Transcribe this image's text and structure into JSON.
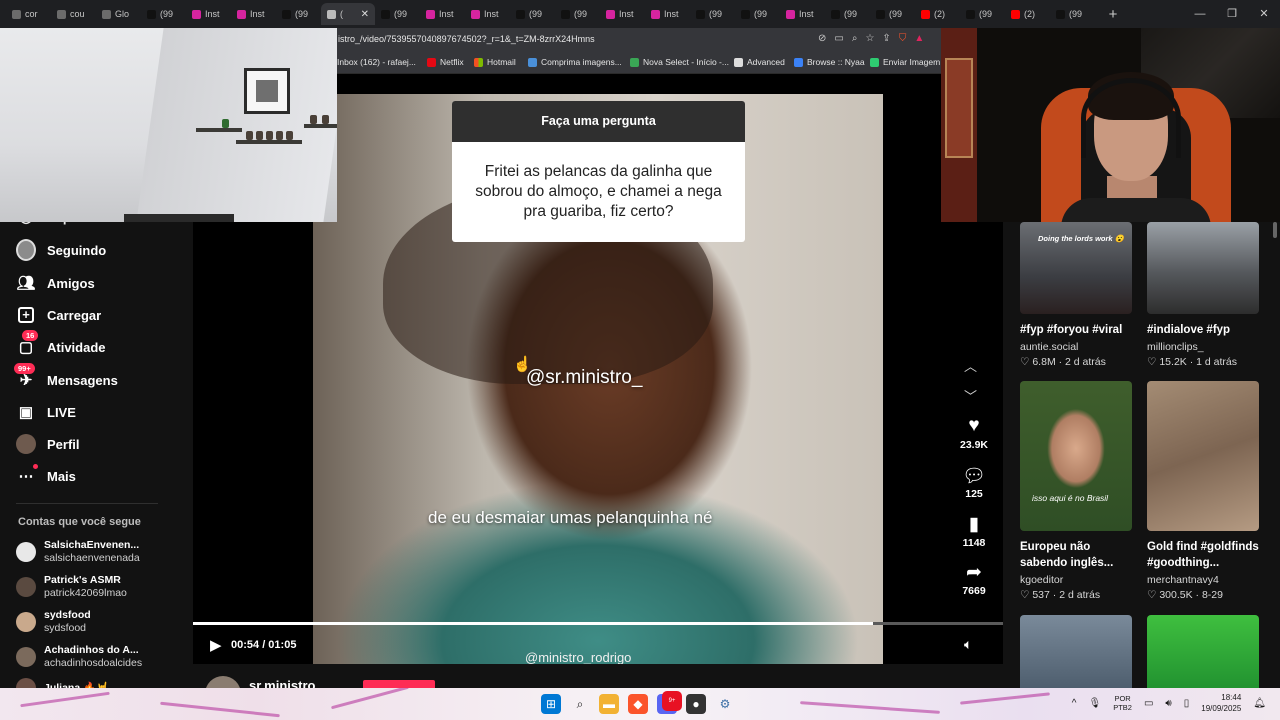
{
  "browser": {
    "tabs": [
      {
        "label": "cor",
        "icon": "search-icon",
        "color": "#6b6b6b"
      },
      {
        "label": "cou",
        "icon": "search-icon",
        "color": "#6b6b6b"
      },
      {
        "label": "Glo",
        "icon": "search-icon",
        "color": "#6b6b6b"
      },
      {
        "label": "(99",
        "icon": "tiktok-icon",
        "color": "#111111"
      },
      {
        "label": "Inst",
        "icon": "instagram-icon",
        "color": "#d6249f"
      },
      {
        "label": "Inst",
        "icon": "instagram-icon",
        "color": "#d6249f"
      },
      {
        "label": "(99",
        "icon": "tiktok-icon",
        "color": "#111111"
      },
      {
        "label": "(",
        "icon": "speaker-icon",
        "color": "#bbbbbb",
        "active": true
      },
      {
        "label": "(99",
        "icon": "tiktok-icon",
        "color": "#111111"
      },
      {
        "label": "Inst",
        "icon": "instagram-icon",
        "color": "#d6249f"
      },
      {
        "label": "Inst",
        "icon": "instagram-icon",
        "color": "#d6249f"
      },
      {
        "label": "(99",
        "icon": "tiktok-icon",
        "color": "#111111"
      },
      {
        "label": "(99",
        "icon": "tiktok-icon",
        "color": "#111111"
      },
      {
        "label": "Inst",
        "icon": "instagram-icon",
        "color": "#d6249f"
      },
      {
        "label": "Inst",
        "icon": "instagram-icon",
        "color": "#d6249f"
      },
      {
        "label": "(99",
        "icon": "tiktok-icon",
        "color": "#111111"
      },
      {
        "label": "(99",
        "icon": "tiktok-icon",
        "color": "#111111"
      },
      {
        "label": "Inst",
        "icon": "instagram-icon",
        "color": "#d6249f"
      },
      {
        "label": "(99",
        "icon": "tiktok-icon",
        "color": "#111111"
      },
      {
        "label": "(99",
        "icon": "tiktok-icon",
        "color": "#111111"
      },
      {
        "label": "(2)",
        "icon": "youtube-icon",
        "color": "#ff0000"
      },
      {
        "label": "(99",
        "icon": "tiktok-icon",
        "color": "#111111"
      },
      {
        "label": "(2)",
        "icon": "youtube-icon",
        "color": "#ff0000"
      },
      {
        "label": "(99",
        "icon": "tiktok-icon",
        "color": "#111111"
      }
    ],
    "new_tab": "+",
    "url": "istro_/video/7539557040897674502?_r=1&_t=ZM-8zrrX24Hmns",
    "bookmarks": [
      {
        "label": "Inbox (162) - rafaej...",
        "color": "#ea4335"
      },
      {
        "label": "Netflix",
        "color": "#e50914"
      },
      {
        "label": "Hotmail",
        "color": "#f25022"
      },
      {
        "label": "Comprima imagens...",
        "color": "#4a90d9"
      },
      {
        "label": "Nova Select - Início -...",
        "color": "#3aa655"
      },
      {
        "label": "Advanced",
        "color": "#dddddd"
      },
      {
        "label": "Browse :: Nyaa",
        "color": "#3b82f6"
      },
      {
        "label": "Enviar Imagem p",
        "color": "#2ecc71"
      }
    ]
  },
  "sidebar": {
    "nav": [
      {
        "label": "Explorar",
        "icon": "compass-icon"
      },
      {
        "label": "Seguindo",
        "icon": "following-avatar-icon"
      },
      {
        "label": "Amigos",
        "icon": "friends-icon"
      },
      {
        "label": "Carregar",
        "icon": "upload-icon"
      },
      {
        "label": "Atividade",
        "icon": "activity-icon",
        "badge": "16"
      },
      {
        "label": "Mensagens",
        "icon": "messages-icon",
        "badge": "99+"
      },
      {
        "label": "LIVE",
        "icon": "live-icon"
      },
      {
        "label": "Perfil",
        "icon": "profile-avatar-icon"
      },
      {
        "label": "Mais",
        "icon": "more-icon"
      }
    ],
    "following_title": "Contas que você segue",
    "accounts": [
      {
        "name": "SalsichaEnvenen...",
        "handle": "salsichaenvenenada"
      },
      {
        "name": "Patrick's ASMR",
        "handle": "patrick42069lmao"
      },
      {
        "name": "sydsfood",
        "handle": "sydsfood"
      },
      {
        "name": "Achadinhos do A...",
        "handle": "achadinhosdoalcides"
      },
      {
        "name": "Juliana 🔥🤘",
        "handle": ""
      }
    ]
  },
  "video": {
    "question_header": "Faça uma pergunta",
    "question_text": "Fritei as pelancas da galinha que sobrou do almoço, e chamei a nega pra guariba, fiz certo?",
    "handle_overlay": "@sr.ministro_",
    "caption": "de eu desmaiar umas pelanquinha né",
    "bottom_handle": "@ministro_rodrigo",
    "time": "00:54 / 01:05",
    "progress": 0.84,
    "likes": "23.9K",
    "comments": "125",
    "saves": "1148",
    "shares": "7669",
    "author": "sr.ministro"
  },
  "feed": [
    {
      "title": "#fyp #foryou #viral",
      "user": "auntie.social",
      "views": "6.8M",
      "age": "2 d atrás",
      "overlay": "Doing the lords work 😮"
    },
    {
      "title": "#indialove #fyp",
      "user": "millionclips_",
      "views": "15.2K",
      "age": "1 d atrás"
    },
    {
      "title": "Europeu não sabendo inglês...",
      "user": "kgoeditor",
      "views": "537",
      "age": "2 d atrás",
      "overlay": "isso aqui é no Brasil"
    },
    {
      "title": "Gold find #goldfinds #goodthing...",
      "user": "merchantnavy4",
      "views": "300.5K",
      "age": "8-29"
    }
  ],
  "taskbar": {
    "lang_top": "POR",
    "lang_bottom": "PTB2",
    "time": "18:44",
    "date": "19/09/2025",
    "notify_badge": "9+"
  }
}
